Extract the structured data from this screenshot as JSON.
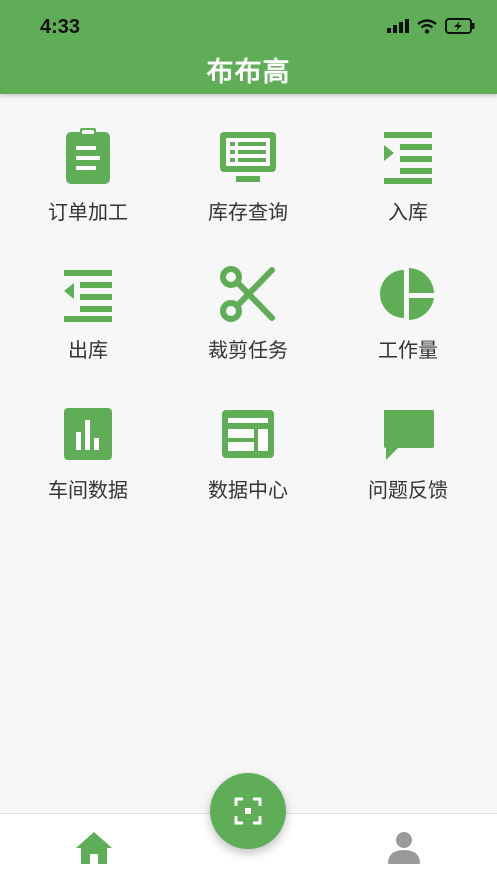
{
  "status_bar": {
    "time": "4:33"
  },
  "header": {
    "title": "布布高"
  },
  "menu": [
    {
      "label": "订单加工",
      "icon": "clipboard-icon"
    },
    {
      "label": "库存查询",
      "icon": "monitor-list-icon"
    },
    {
      "label": "入库",
      "icon": "indent-in-icon"
    },
    {
      "label": "出库",
      "icon": "indent-out-icon"
    },
    {
      "label": "裁剪任务",
      "icon": "scissors-icon"
    },
    {
      "label": "工作量",
      "icon": "pie-chart-icon"
    },
    {
      "label": "车间数据",
      "icon": "bar-chart-icon"
    },
    {
      "label": "数据中心",
      "icon": "data-panel-icon"
    },
    {
      "label": "问题反馈",
      "icon": "chat-bubble-icon"
    }
  ],
  "tabbar": {
    "home": "home-icon",
    "profile": "person-icon",
    "scan": "scan-icon"
  },
  "colors": {
    "accent": "#5fae57"
  }
}
